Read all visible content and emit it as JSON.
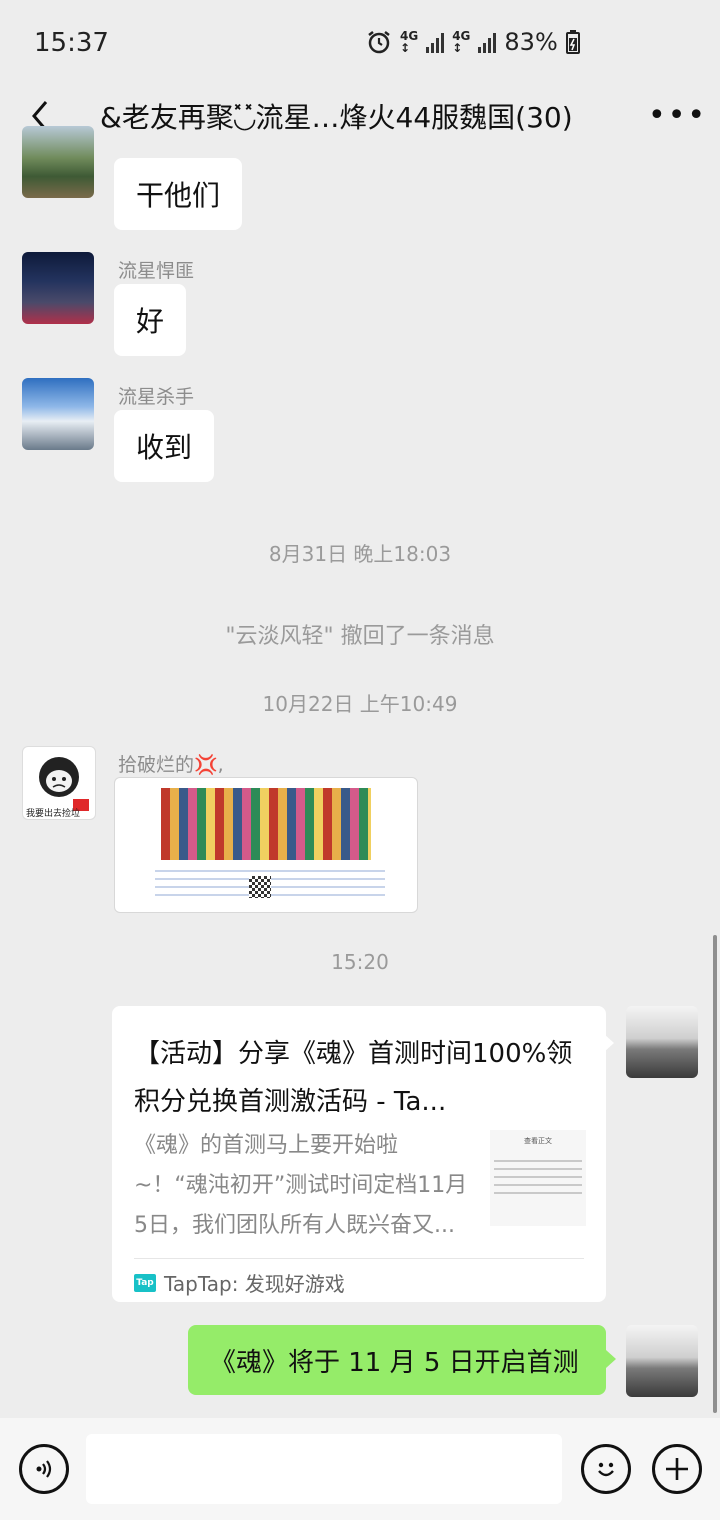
{
  "status": {
    "time": "15:37",
    "net1": "4G",
    "net2": "4G",
    "battery": "83%"
  },
  "header": {
    "title": "&老友再聚◟̽◞̽流星…烽火44服魏国(30)"
  },
  "messages": {
    "m1": {
      "text": "干他们"
    },
    "m2": {
      "sender": "流星悍匪",
      "text": "好"
    },
    "m3": {
      "sender": "流星杀手",
      "text": "收到"
    },
    "time1": "8月31日 晚上18:03",
    "recall": "\"云淡风轻\" 撤回了一条消息",
    "time2": "10月22日 上午10:49",
    "m4": {
      "sender": "拾破烂的💢,",
      "avatar_caption": "我要出去捡垃"
    },
    "time3": "15:20",
    "card": {
      "title": "【活动】分享《魂》首测时间100%领积分兑换首测激活码 - Ta...",
      "desc": "《魂》的首测马上要开始啦~！“魂沌初开”测试时间定档11月5日，我们团队所有人既兴奋又...",
      "thumb_heading": "查看正文",
      "source_logo": "Tap",
      "source": "TapTap: 发现好游戏"
    },
    "m5": {
      "text": "《魂》将于 11 月 5 日开启首测"
    }
  },
  "colors": {
    "bg": "#ededed",
    "bubble_self": "#95ec69",
    "bubble_other": "#ffffff",
    "tap_brand": "#18c1c7"
  },
  "icons": {
    "back": "chevron-left-icon",
    "more": "more-dots-icon",
    "voice": "voice-icon",
    "emoji": "emoji-icon",
    "plus": "plus-icon"
  }
}
